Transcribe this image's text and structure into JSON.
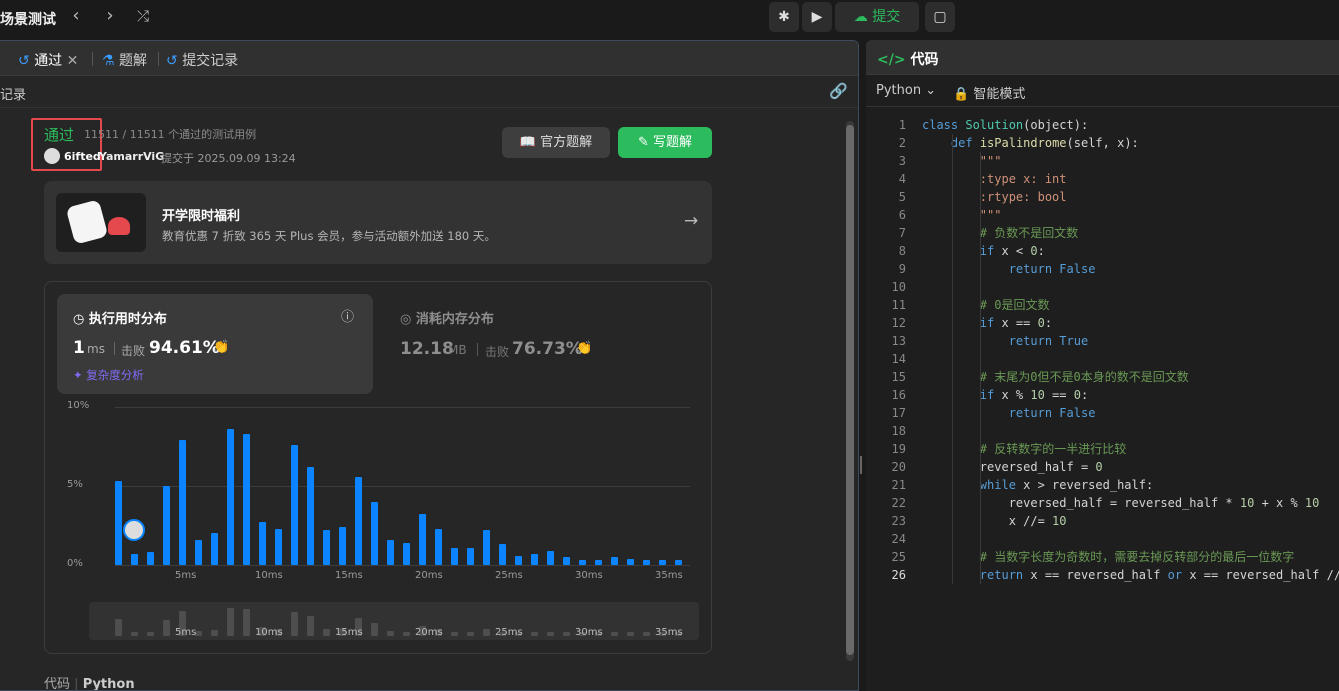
{
  "topbar": {
    "title": "场景测试",
    "submit": "提交"
  },
  "tabs": {
    "passed": "通过",
    "solution": "题解",
    "submissions": "提交记录"
  },
  "record_label": "记录",
  "result": {
    "status": "通过",
    "cases": "11511 / 11511 个通过的测试用例",
    "user": "6ifted",
    "user2": "YamarrViG",
    "submitted": "提交于 2025.09.09 13:24",
    "official_btn": "官方题解",
    "write_btn": "写题解"
  },
  "promo": {
    "title": "开学限时福利",
    "desc": "教育优惠 7 折致 365 天 Plus 会员，参与活动额外加送 180 天。"
  },
  "runtime": {
    "title": "执行用时分布",
    "value": "1",
    "unit": "ms",
    "beat_label": "击败",
    "beat": "94.61%",
    "complexity": "复杂度分析"
  },
  "memory": {
    "title": "消耗内存分布",
    "value": "12.18",
    "unit": "MB",
    "beat_label": "击败",
    "beat": "76.73%"
  },
  "chart_data": {
    "type": "bar",
    "ylabels": [
      "10%",
      "5%",
      "0%"
    ],
    "ylim": [
      0,
      10
    ],
    "xticks": [
      "5ms",
      "10ms",
      "15ms",
      "20ms",
      "25ms",
      "30ms",
      "35ms"
    ],
    "values": [
      5.3,
      0.7,
      0.8,
      5.0,
      7.9,
      1.6,
      2.0,
      8.6,
      8.3,
      2.7,
      2.3,
      7.6,
      6.2,
      2.2,
      2.4,
      5.6,
      4.0,
      1.6,
      1.4,
      3.2,
      2.3,
      1.1,
      1.1,
      2.2,
      1.3,
      0.6,
      0.7,
      0.9,
      0.5,
      0.3,
      0.3,
      0.5,
      0.4,
      0.3,
      0.3,
      0.3
    ],
    "highlight_index": 1
  },
  "bottom": {
    "label": "代码",
    "lang": "Python"
  },
  "right": {
    "tab": "代码",
    "lang": "Python",
    "mode": "智能模式"
  },
  "code": [
    "class Solution(object):",
    "    def isPalindrome(self, x):",
    "        \"\"\"",
    "        :type x: int",
    "        :rtype: bool",
    "        \"\"\"",
    "        # 负数不是回文数",
    "        if x < 0:",
    "            return False",
    "",
    "        # 0是回文数",
    "        if x == 0:",
    "            return True",
    "",
    "        # 末尾为0但不是0本身的数不是回文数",
    "        if x % 10 == 0:",
    "            return False",
    "",
    "        # 反转数字的一半进行比较",
    "        reversed_half = 0",
    "        while x > reversed_half:",
    "            reversed_half = reversed_half * 10 + x % 10",
    "            x //= 10",
    "",
    "        # 当数字长度为奇数时，需要去掉反转部分的最后一位数字",
    "        return x == reversed_half or x == reversed_half //"
  ]
}
